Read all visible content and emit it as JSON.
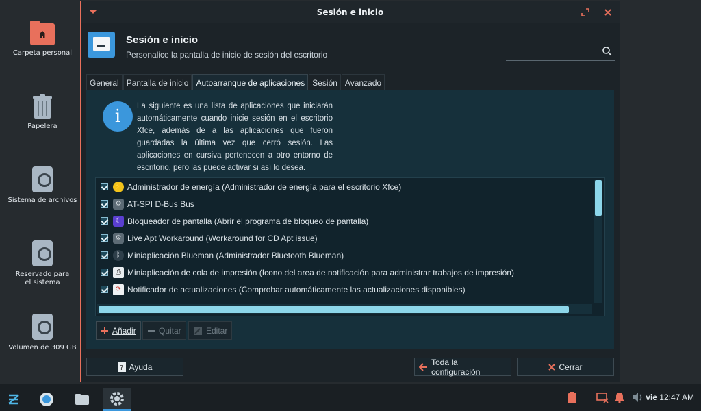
{
  "desktop": {
    "icons": [
      {
        "label": "Carpeta personal"
      },
      {
        "label": "Papelera"
      },
      {
        "label": "Sistema de archivos"
      },
      {
        "label": "Reservado para el sistema"
      },
      {
        "label": "Volumen de 309 GB"
      }
    ]
  },
  "window": {
    "title": "Sesión e inicio",
    "header_title": "Sesión e inicio",
    "header_subtitle": "Personalice la pantalla de inicio de sesión del escritorio",
    "search_placeholder": "",
    "tabs": [
      {
        "label": "General"
      },
      {
        "label": "Pantalla de inicio"
      },
      {
        "label": "Autoarranque de aplicaciones",
        "active": true
      },
      {
        "label": "Sesión"
      },
      {
        "label": "Avanzado"
      }
    ],
    "info_text": "La siguiente es una lista de aplicaciones que iniciarán automáticamente cuando inicie sesión en el escritorio Xfce, además de a las aplicaciones que fueron guardadas la última vez que cerró sesión. Las aplicaciones en cursiva pertenecen a otro entorno de escritorio, pero las puede activar si así lo desea.",
    "autostart_items": [
      {
        "label": "Administrador de energía (Administrador de energía para el escritorio Xfce)",
        "icon": "power-icon",
        "checked": true
      },
      {
        "label": "AT-SPI D-Bus Bus",
        "icon": "gear-icon",
        "checked": true
      },
      {
        "label": "Bloqueador de pantalla (Abrir el programa de bloqueo de pantalla)",
        "icon": "moon-icon",
        "checked": true
      },
      {
        "label": "Live Apt Workaround (Workaround for CD Apt issue)",
        "icon": "gear-icon",
        "checked": true
      },
      {
        "label": "Miniaplicación Blueman (Administrador Bluetooth Blueman)",
        "icon": "bluetooth-icon",
        "checked": true
      },
      {
        "label": "Miniaplicación de cola de impresión (Icono del area de notificación para administrar trabajos de impresión)",
        "icon": "printer-icon",
        "checked": true
      },
      {
        "label": "Notificador de actualizaciones (Comprobar automáticamente las actualizaciones disponibles)",
        "icon": "update-icon",
        "checked": true
      }
    ],
    "buttons": {
      "add": "Añadir",
      "remove": "Quitar",
      "edit": "Editar",
      "help": "Ayuda",
      "all_settings": "Toda la configuración",
      "close": "Cerrar"
    },
    "accent_color": "#3b97dc",
    "border_color": "#e8705c"
  },
  "taskbar": {
    "day": "vie",
    "time": "12:47 AM"
  }
}
